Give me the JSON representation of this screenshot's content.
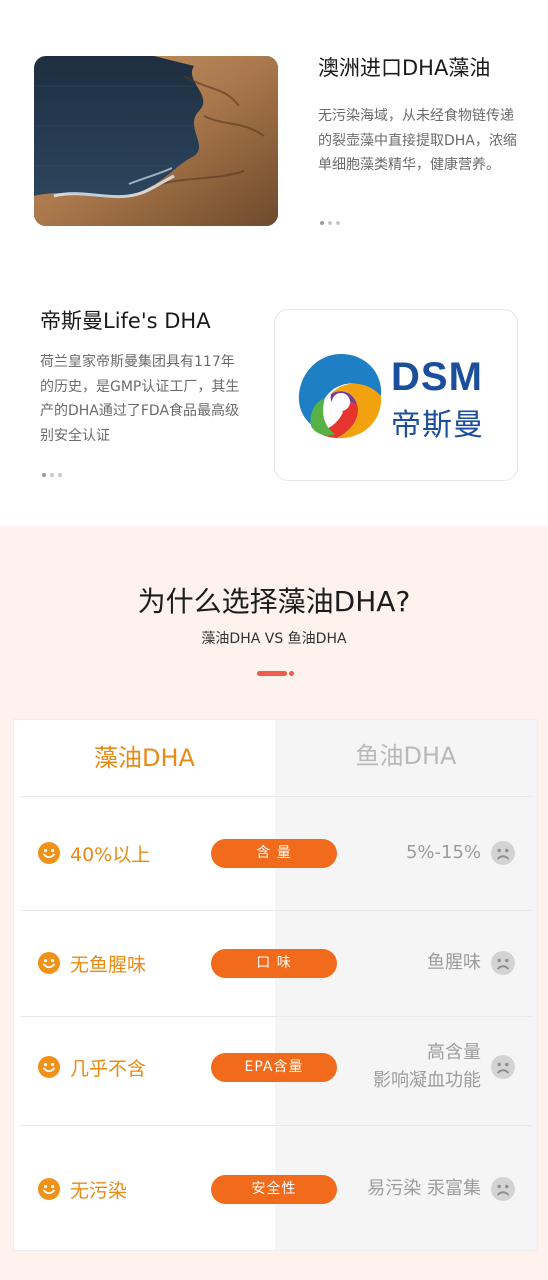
{
  "intro": {
    "title": "澳洲进口DHA藻油",
    "description": "无污染海域，从未经食物链传递的裂壶藻中直接提取DHA，浓缩单细胞藻类精华，健康营养。"
  },
  "brand": {
    "title": "帝斯曼Life's DHA",
    "description": "荷兰皇家帝斯曼集团具有117年的历史，是GMP认证工厂，其生产的DHA通过了FDA食品最高级别安全认证",
    "logo_text": "DSM",
    "logo_cn": "帝斯曼"
  },
  "compare": {
    "heading": "为什么选择藻油DHA?",
    "subheading": "藻油DHA  VS  鱼油DHA",
    "left_header": "藻油DHA",
    "right_header": "鱼油DHA",
    "rows": [
      {
        "good": "40%以上",
        "label": "含  量",
        "bad": "5%-15%"
      },
      {
        "good": "无鱼腥味",
        "label": "口  味",
        "bad": "鱼腥味"
      },
      {
        "good": "几乎不含",
        "label": "EPA含量",
        "bad": "高含量",
        "bad2": "影响凝血功能"
      },
      {
        "good": "无污染",
        "label": "安全性",
        "bad": "易污染 汞富集"
      }
    ]
  },
  "colors": {
    "accent_orange": "#f26a1b",
    "good_text": "#e98a15",
    "accent_red": "#ef5b4d",
    "dsm_blue": "#1b4f9c"
  },
  "icons": {
    "good": "smiley-face-icon",
    "bad": "frown-face-icon"
  }
}
